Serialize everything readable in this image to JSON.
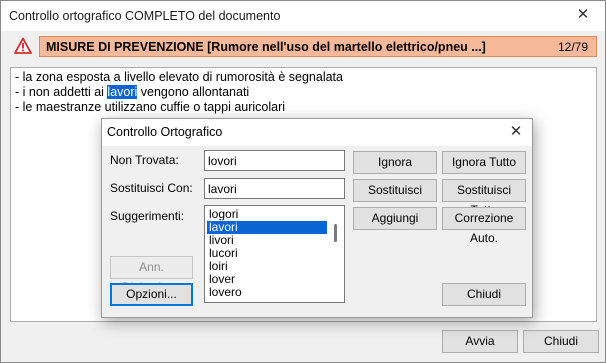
{
  "window": {
    "title": "Controllo ortografico COMPLETO del documento",
    "close_glyph": "✕"
  },
  "header": {
    "text": "MISURE DI PREVENZIONE [Rumore nell'uso del martello elettrico/pneu ...]",
    "counter": "12/79",
    "icon": "warning-icon",
    "bar_color": "#f7b99a"
  },
  "document": {
    "lines": [
      {
        "text": "- la zona esposta a livello elevato di rumorosità è segnalata"
      },
      {
        "before": "- i non addetti ai ",
        "highlight": "lavori",
        "after": " vengono allontanati"
      },
      {
        "text": "- le maestranze utilizzano cuffie o tappi auricolari"
      }
    ],
    "highlight_color": "#0a64d2"
  },
  "dialog": {
    "title": "Controllo Ortografico",
    "close_glyph": "✕",
    "not_found_label": "Non Trovata:",
    "not_found_value": "lovori",
    "replace_label": "Sostituisci Con:",
    "replace_value": "lavori",
    "suggestions_label": "Suggerimenti:",
    "suggestions": [
      "logori",
      "lavori",
      "livori",
      "lucori",
      "loiri",
      "lover",
      "lovero"
    ],
    "selected_suggestion": "lavori",
    "buttons": {
      "ignore": "Ignora",
      "ignore_all": "Ignora Tutto",
      "replace": "Sostituisci",
      "replace_all": "Sostituisci Tutto",
      "add": "Aggiungi",
      "autocorrect": "Correzione Auto.",
      "undo_typing": "Ann. Digitazione",
      "options": "Opzioni...",
      "close": "Chiudi"
    }
  },
  "footer": {
    "start_label": "Avvia",
    "close_label": "Chiudi"
  }
}
